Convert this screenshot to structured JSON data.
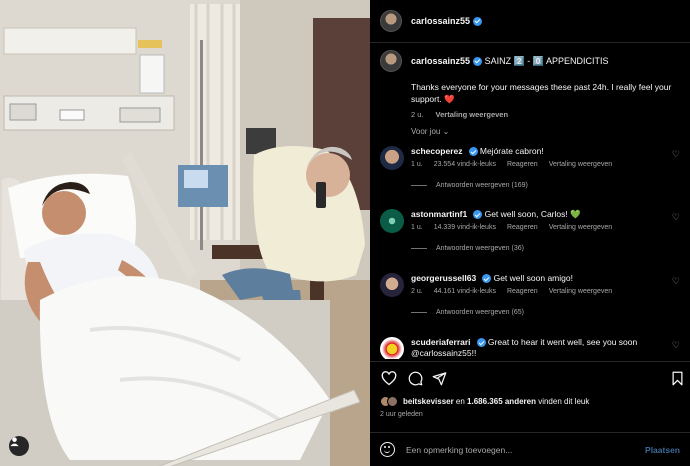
{
  "post": {
    "username": "carlossainz55",
    "caption_title": "SAINZ 2️⃣ - 0️⃣ APPENDICITIS",
    "caption_body": "Thanks everyone for your messages these past 24h. I really feel your support.",
    "caption_heart": "❤️",
    "time": "2 u.",
    "translate": "Vertaling weergeven"
  },
  "for_you": "Voor jou",
  "comments": [
    {
      "user": "schecoperez",
      "text": "Mejórate cabron!",
      "emoji": "",
      "time": "1 u.",
      "likes": "23.554 vind-ik-leuks",
      "reply": "Reageren",
      "translate": "Vertaling weergeven",
      "replies": "Antwoorden weergeven (169)"
    },
    {
      "user": "astonmartinf1",
      "text": "Get well soon, Carlos!",
      "emoji": "💚",
      "time": "1 u.",
      "likes": "14.339 vind-ik-leuks",
      "reply": "Reageren",
      "translate": "Vertaling weergeven",
      "replies": "Antwoorden weergeven (36)"
    },
    {
      "user": "georgerussell63",
      "text": "Get well soon amigo!",
      "emoji": "",
      "time": "2 u.",
      "likes": "44.161 vind-ik-leuks",
      "reply": "Reageren",
      "translate": "Vertaling weergeven",
      "replies": "Antwoorden weergeven (65)"
    },
    {
      "user": "scuderiaferrari",
      "text": "Great to hear it went well, see you soon @carlossainz55!!",
      "emoji": ""
    }
  ],
  "likes": {
    "user": "beitskevisser",
    "middle": " en ",
    "count": "1.686.365 anderen",
    "suffix": " vinden dit leuk"
  },
  "posted_ago": "2 uur geleden",
  "add_comment": {
    "placeholder": "Een opmerking toevoegen...",
    "post_label": "Plaatsen"
  },
  "colors": {
    "verified": "#3897f0",
    "post_button": "#3d6a9a",
    "secondary_text": "#a8a8a8"
  }
}
